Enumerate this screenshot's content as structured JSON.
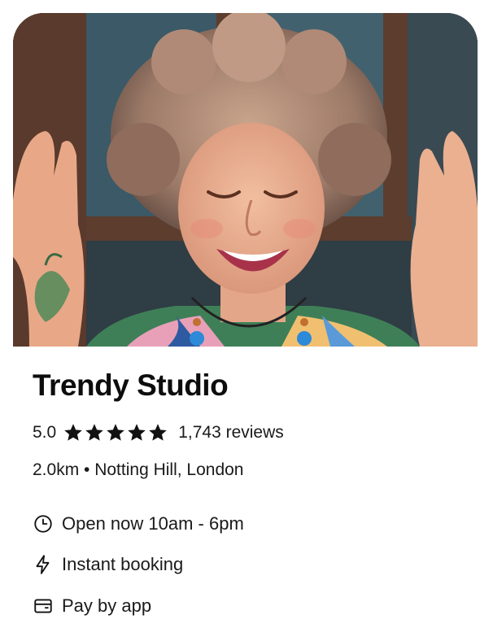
{
  "venue": {
    "name": "Trendy Studio",
    "rating": "5.0",
    "stars": 5,
    "reviews": "1,743 reviews",
    "location": "2.0km • Notting Hill, London"
  },
  "features": [
    {
      "label": "Open now 10am - 6pm",
      "icon": "clock-icon"
    },
    {
      "label": "Instant booking",
      "icon": "lightning-icon"
    },
    {
      "label": "Pay by app",
      "icon": "wallet-icon"
    }
  ],
  "colors": {
    "text": "#111111",
    "star": "#111111",
    "background": "#ffffff"
  }
}
